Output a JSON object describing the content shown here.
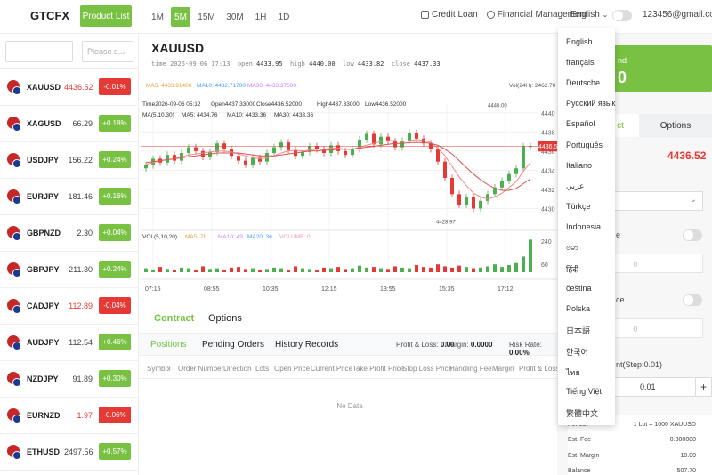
{
  "brand": "GTCFX",
  "product_list": "Product List",
  "timeframes": [
    "1M",
    "5M",
    "15M",
    "30M",
    "1H",
    "1D"
  ],
  "active_timeframe": "5M",
  "top_links": {
    "credit_loan": "Credit Loan",
    "financial": "Financial Management"
  },
  "language": "English",
  "email": "123456@gmail.com",
  "search_placeholder": "Please s...",
  "symbols": [
    {
      "name": "XAUUSD",
      "price": "4436.52",
      "change": "-0.01%",
      "dir": "dn"
    },
    {
      "name": "XAGUSD",
      "price": "66.29",
      "change": "+0.18%",
      "dir": "up"
    },
    {
      "name": "USDJPY",
      "price": "156.22",
      "change": "+0.24%",
      "dir": "up"
    },
    {
      "name": "EURJPY",
      "price": "181.46",
      "change": "+0.16%",
      "dir": "up"
    },
    {
      "name": "GBPNZD",
      "price": "2.30",
      "change": "+0.04%",
      "dir": "up"
    },
    {
      "name": "GBPJPY",
      "price": "211.30",
      "change": "+0.24%",
      "dir": "up"
    },
    {
      "name": "CADJPY",
      "price": "112.89",
      "change": "-0.04%",
      "dir": "dn"
    },
    {
      "name": "AUDJPY",
      "price": "112.54",
      "change": "+0.46%",
      "dir": "up"
    },
    {
      "name": "NZDJPY",
      "price": "91.89",
      "change": "+0.30%",
      "dir": "up"
    },
    {
      "name": "EURNZD",
      "price": "1.97",
      "change": "-0.06%",
      "dir": "dn"
    },
    {
      "name": "ETHUSD",
      "price": "2497.56",
      "change": "+0.57%",
      "dir": "up"
    }
  ],
  "chart_header": {
    "symbol": "XAUUSD",
    "time_line": "time 2026-09-06 17:13",
    "open_label": "open",
    "open": "4433.95",
    "high_label": "high",
    "high": "4440.00",
    "low_label": "low",
    "low": "4433.82",
    "close_label": "close",
    "close": "4437.33"
  },
  "chart_text": {
    "ma_top": [
      "MA5: 4433.91400",
      "MA10: 4432.71700",
      "MA30: 4433.37500"
    ],
    "vol_24h": "Vol(24H): 2462.70",
    "ohlc_line": [
      "Time2026-09-06 05:12",
      "Open4437.33000",
      "Close4436.52000",
      "High4437.33000",
      "Low4436.52000"
    ],
    "ma_line": [
      "MA(5,10,30)",
      "MA5: 4434.76",
      "MA10: 4433.36",
      "MA30: 4433.36"
    ],
    "vol_line": [
      "VOL(5,10,20)",
      "MA5: 78",
      "MA10: 49",
      "MA20: 36",
      "VOLUME: 0"
    ],
    "max_label": "4440.00",
    "min_label": "4428.97",
    "price_tag": "4436.52"
  },
  "chart_data": {
    "type": "line",
    "x_ticks": [
      "07:15",
      "08:55",
      "10:35",
      "12:15",
      "13:55",
      "15:35",
      "17:12"
    ],
    "y_ticks": [
      4440,
      4438,
      4436,
      4434,
      4432,
      4430
    ],
    "ylim": [
      4428,
      4441
    ],
    "vol_ticks": [
      240,
      60
    ],
    "vol_ylim": [
      0,
      300
    ],
    "close": [
      4434.5,
      4435.2,
      4434.8,
      4435.6,
      4435.0,
      4435.8,
      4436.4,
      4436.0,
      4435.4,
      4435.9,
      4436.8,
      4436.2,
      4435.5,
      4435.0,
      4434.6,
      4435.3,
      4434.9,
      4435.8,
      4436.4,
      4436.9,
      4436.1,
      4435.5,
      4435.9,
      4436.5,
      4436.2,
      4435.8,
      4436.6,
      4436.0,
      4435.6,
      4436.2,
      4437.2,
      4437.8,
      4436.7,
      4437.5,
      4437.0,
      4436.4,
      4437.1,
      4437.9,
      4437.3,
      4436.8,
      4436.2,
      4434.9,
      4433.2,
      4431.5,
      4430.4,
      4431.2,
      4430.0,
      4430.8,
      4431.5,
      4432.2,
      4432.9,
      4433.6,
      4434.2,
      4436.5,
      4436.52
    ],
    "ma_fast": [
      4434.6,
      4434.8,
      4435.0,
      4435.1,
      4435.2,
      4435.4,
      4435.6,
      4435.7,
      4435.8,
      4435.9,
      4436.0,
      4436.0,
      4435.9,
      4435.7,
      4435.5,
      4435.3,
      4435.2,
      4435.3,
      4435.5,
      4435.8,
      4436.0,
      4436.1,
      4436.0,
      4436.1,
      4436.2,
      4436.2,
      4436.3,
      4436.3,
      4436.2,
      4436.2,
      4436.4,
      4436.6,
      4436.8,
      4437.0,
      4437.1,
      4437.1,
      4437.0,
      4437.1,
      4437.2,
      4437.1,
      4436.9,
      4436.3,
      4435.5,
      4434.4,
      4433.3,
      4432.4,
      4431.6,
      4431.2,
      4431.0,
      4431.2,
      4431.6,
      4432.2,
      4432.8,
      4433.9,
      4434.8
    ],
    "ma_slow": [
      4434.8,
      4434.9,
      4435.0,
      4435.1,
      4435.2,
      4435.3,
      4435.4,
      4435.5,
      4435.6,
      4435.7,
      4435.8,
      4435.8,
      4435.8,
      4435.8,
      4435.7,
      4435.6,
      4435.5,
      4435.5,
      4435.5,
      4435.6,
      4435.7,
      4435.8,
      4435.9,
      4436.0,
      4436.0,
      4436.1,
      4436.1,
      4436.2,
      4436.2,
      4436.2,
      4436.3,
      4436.4,
      4436.5,
      4436.6,
      4436.7,
      4436.8,
      4436.8,
      4436.9,
      4436.9,
      4436.9,
      4436.8,
      4436.6,
      4436.2,
      4435.7,
      4435.0,
      4434.3,
      4433.6,
      4433.0,
      4432.5,
      4432.1,
      4431.9,
      4431.9,
      4432.1,
      4432.6,
      4433.1
    ],
    "volume": [
      30,
      20,
      40,
      25,
      15,
      35,
      30,
      20,
      45,
      25,
      30,
      20,
      35,
      40,
      25,
      30,
      20,
      25,
      35,
      30,
      20,
      45,
      30,
      25,
      20,
      35,
      30,
      40,
      25,
      30,
      50,
      35,
      40,
      30,
      25,
      45,
      35,
      30,
      55,
      40,
      35,
      60,
      45,
      35,
      50,
      40,
      30,
      35,
      45,
      60,
      40,
      55,
      70,
      120,
      250
    ]
  },
  "bottom_tabs": {
    "contract": "Contract",
    "options": "Options"
  },
  "position_tabs": {
    "positions": "Positions",
    "pending": "Pending Orders",
    "history": "History Records",
    "pl_label": "Profit & Loss:",
    "pl": "0.00",
    "margin_label": "Margin:",
    "margin": "0.0000",
    "risk_label": "Risk Rate:",
    "risk": "0.00%"
  },
  "table_headers": [
    "Symbol",
    "Order Number",
    "Direction",
    "Lots",
    "Open Price",
    "Current Price",
    "Take Profit Price",
    "Stop Loss Price",
    "Handling Fee",
    "Margin",
    "Profit & Loss"
  ],
  "no_data": "No Data",
  "right_panel": {
    "top_partial": "nd",
    "top_value": "0",
    "tab_contract": "ct",
    "tab_options": "Options",
    "price": "4436.52",
    "label_e": "e",
    "label_ce": "ce",
    "input_zero": "0",
    "lots_label": "nt(Step:0.01)",
    "lots_value": "0.01",
    "plus": "+",
    "info": [
      {
        "k": "Per Lot",
        "v": "1 Lot = 1000 XAUUSD"
      },
      {
        "k": "Est. Fee",
        "v": "0.300000"
      },
      {
        "k": "Est. Margin",
        "v": "10.00"
      },
      {
        "k": "Balance",
        "v": "507.70"
      }
    ]
  },
  "languages": [
    "English",
    "français",
    "Deutsche",
    "Русский язык",
    "Español",
    "Português",
    "Italiano",
    "عربي",
    "Türkçe",
    "Indonesia",
    "ဗမာ",
    "हिंदी",
    "čeština",
    "Polska",
    "日本語",
    "한국어",
    "ไทย",
    "Tiếng Việt",
    "繁體中文"
  ]
}
